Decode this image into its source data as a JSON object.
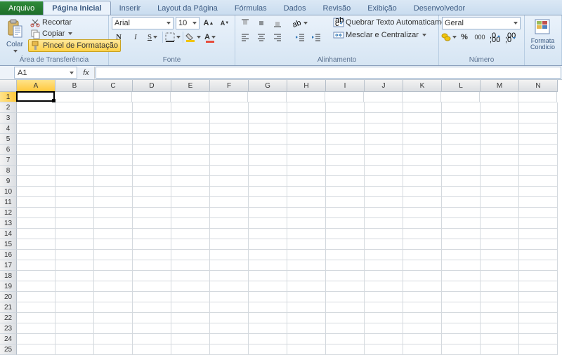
{
  "tabs": {
    "file": "Arquivo",
    "home": "Página Inicial",
    "insert": "Inserir",
    "layout": "Layout da Página",
    "formulas": "Fórmulas",
    "data": "Dados",
    "review": "Revisão",
    "view": "Exibição",
    "dev": "Desenvolvedor"
  },
  "clipboard": {
    "paste": "Colar",
    "cut": "Recortar",
    "copy": "Copiar",
    "format_painter": "Pincel de Formatação",
    "group": "Área de Transferência"
  },
  "font": {
    "name": "Arial",
    "size": "10",
    "group": "Fonte"
  },
  "align": {
    "wrap": "Quebrar Texto Automaticamente",
    "merge": "Mesclar e Centralizar",
    "group": "Alinhamento"
  },
  "number": {
    "format": "Geral",
    "group": "Número",
    "pct": "%",
    "sep": "000",
    "inc": ",0",
    ".dec": ",00"
  },
  "styles": {
    "cond": "Formata Condicio"
  },
  "namebox": "A1",
  "fx": "fx",
  "columns": [
    "A",
    "B",
    "C",
    "D",
    "E",
    "F",
    "G",
    "H",
    "I",
    "J",
    "K",
    "L",
    "M",
    "N"
  ],
  "rows": 25,
  "active": {
    "col": 0,
    "row": 0
  }
}
